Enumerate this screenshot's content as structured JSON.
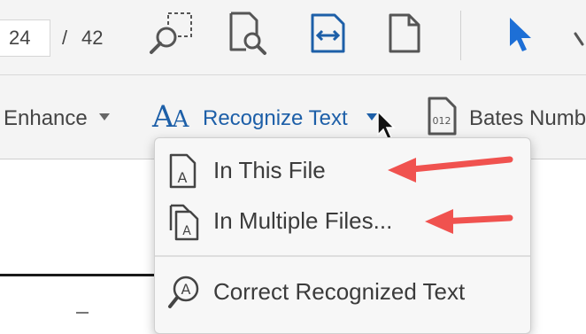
{
  "toolbar": {
    "page_current": "24",
    "page_separator": "/",
    "page_total": "42",
    "icons": [
      "zoom-marquee-icon",
      "find-in-page-icon",
      "fit-width-icon",
      "single-page-icon",
      "select-cursor-icon",
      "hand-icon"
    ]
  },
  "secondary_toolbar": {
    "enhance_label": "Enhance",
    "recognize_label": "Recognize Text",
    "recognize_icon_text": "AA",
    "bates_label": "Bates Numb",
    "bates_icon_text": "012"
  },
  "menu": {
    "items": [
      {
        "label": "In This File",
        "icon": "single-file-a-icon"
      },
      {
        "label": "In Multiple Files...",
        "icon": "multiple-files-a-icon"
      },
      {
        "label": "Correct Recognized Text",
        "icon": "magnifier-a-icon"
      }
    ]
  },
  "colors": {
    "accent_blue": "#1d5fa8",
    "annotation_red": "#f0524f",
    "toolbar_bg": "#f4f4f4"
  }
}
